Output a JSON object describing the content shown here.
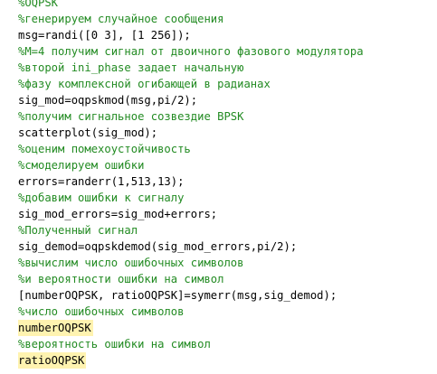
{
  "colors": {
    "background": "#ffffff",
    "code": "#000000",
    "comment": "#228b22",
    "highlight": "#fff3b0"
  },
  "lines": [
    {
      "text": "%OQPSK",
      "kind": "comment",
      "highlight": false
    },
    {
      "text": "%генерируем случайное сообщения",
      "kind": "comment",
      "highlight": false
    },
    {
      "text": "msg=randi([0 3], [1 256]);",
      "kind": "code",
      "highlight": false
    },
    {
      "text": "%M=4 получим сигнал от двоичного фазового модулятора",
      "kind": "comment",
      "highlight": false
    },
    {
      "text": "%второй ini_phase задает начальную",
      "kind": "comment",
      "highlight": false
    },
    {
      "text": "%фазу комплексной огибающей в радианах",
      "kind": "comment",
      "highlight": false
    },
    {
      "text": "sig_mod=oqpskmod(msg,pi/2);",
      "kind": "code",
      "highlight": false
    },
    {
      "text": "%получим сигнальное созвездие BPSK",
      "kind": "comment",
      "highlight": false
    },
    {
      "text": "scatterplot(sig_mod);",
      "kind": "code",
      "highlight": false
    },
    {
      "text": "%оценим помехоустойчивость",
      "kind": "comment",
      "highlight": false
    },
    {
      "text": "%смоделируем ошибки",
      "kind": "comment",
      "highlight": false
    },
    {
      "text": "errors=randerr(1,513,13);",
      "kind": "code",
      "highlight": false
    },
    {
      "text": "%добавим ошибки к сигналу",
      "kind": "comment",
      "highlight": false
    },
    {
      "text": "sig_mod_errors=sig_mod+errors;",
      "kind": "code",
      "highlight": false
    },
    {
      "text": "%Полученный сигнал",
      "kind": "comment",
      "highlight": false
    },
    {
      "text": "sig_demod=oqpskdemod(sig_mod_errors,pi/2);",
      "kind": "code",
      "highlight": false
    },
    {
      "text": "%вычислим число ошибочных символов",
      "kind": "comment",
      "highlight": false
    },
    {
      "text": "%и вероятности ошибки на символ",
      "kind": "comment",
      "highlight": false
    },
    {
      "text": "[numberOQPSK, ratioOQPSK]=symerr(msg,sig_demod);",
      "kind": "code",
      "highlight": false
    },
    {
      "text": "%число ошибочных символов",
      "kind": "comment",
      "highlight": false
    },
    {
      "text": "numberOQPSK",
      "kind": "code",
      "highlight": true
    },
    {
      "text": "%вероятность ошибки на символ",
      "kind": "comment",
      "highlight": false
    },
    {
      "text": "ratioOQPSK",
      "kind": "code",
      "highlight": true
    }
  ]
}
